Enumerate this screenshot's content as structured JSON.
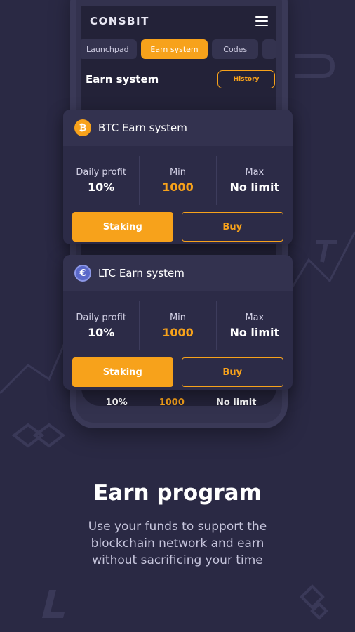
{
  "app": {
    "logo": "CONSBIT"
  },
  "tabs": [
    {
      "label": "Launchpad"
    },
    {
      "label": "Earn system"
    },
    {
      "label": "Codes"
    }
  ],
  "section": {
    "title": "Earn system",
    "history_label": "History"
  },
  "cards": [
    {
      "title": "BTC Earn system",
      "coin_icon": "btc-icon",
      "daily_label": "Daily profit",
      "daily_value": "10%",
      "min_label": "Min",
      "min_value": "1000",
      "max_label": "Max",
      "max_value": "No limit",
      "stake_label": "Staking",
      "buy_label": "Buy"
    },
    {
      "title": "LTC Earn system",
      "coin_icon": "ltc-icon",
      "daily_label": "Daily profit",
      "daily_value": "10%",
      "min_label": "Min",
      "min_value": "1000",
      "max_label": "Max",
      "max_value": "No limit",
      "stake_label": "Staking",
      "buy_label": "Buy"
    }
  ],
  "background_row": {
    "daily_value": "10%",
    "min_value": "1000",
    "max_value": "No limit"
  },
  "promo": {
    "headline": "Earn program",
    "subtext": "Use your funds to support the blockchain network and earn without sacrificing your time"
  },
  "colors": {
    "accent": "#f7a21b",
    "background": "#2a2944",
    "card": "#2c2b47"
  }
}
